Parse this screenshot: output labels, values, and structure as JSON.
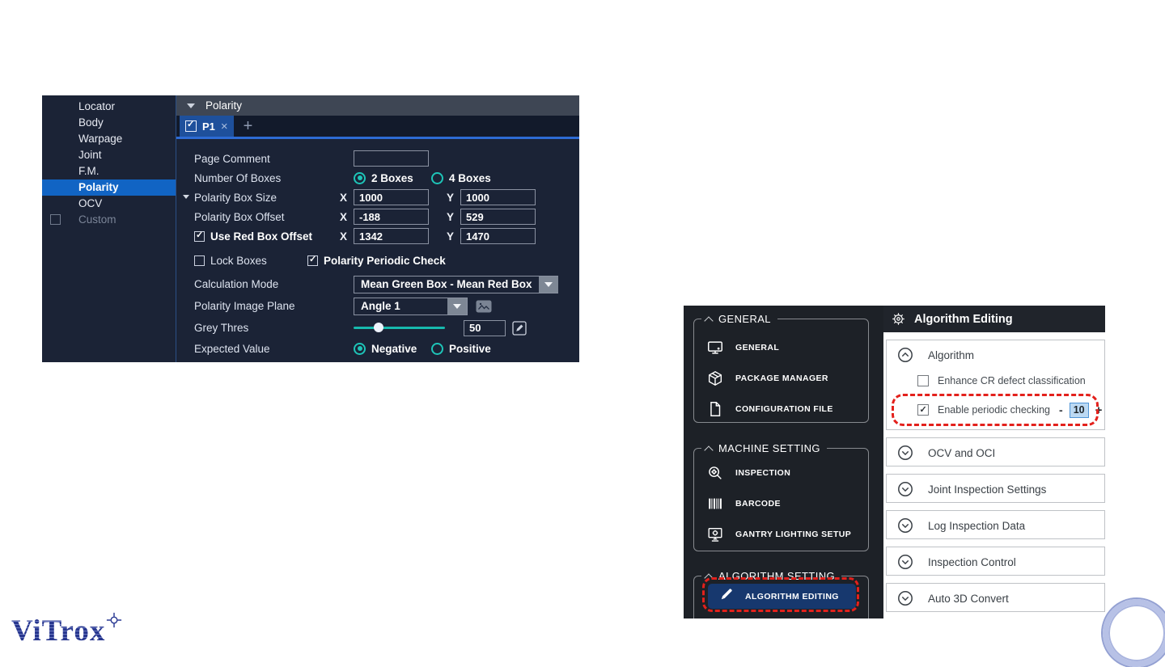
{
  "colors": {
    "left_panel_bg": "#1b2336",
    "left_header_bg": "#3e4654",
    "left_selected_blue": "#1164c4",
    "tab_blue": "#1e509c",
    "tab_underline_blue": "#2d6bd4",
    "teal_accent": "#1ec4b8",
    "input_border": "#8b92a2",
    "right_sidebar_bg": "#1d2127",
    "right_header_bg": "#20242b",
    "algorithm_editing_highlight": "#17386e",
    "annotation_red": "#e3211c",
    "stepper_value_bg": "#bcd9f3",
    "stepper_value_border": "#4f94d6",
    "logo_navy": "#2b3a94",
    "ring_color": "#b7c1e6"
  },
  "logo": {
    "text": "ViTrox",
    "crosshair_icon": "crosshair-icon"
  },
  "left_panel": {
    "sidebar": {
      "items": [
        {
          "label": "Locator"
        },
        {
          "label": "Body"
        },
        {
          "label": "Warpage"
        },
        {
          "label": "Joint"
        },
        {
          "label": "F.M."
        },
        {
          "label": "Polarity",
          "selected": true
        },
        {
          "label": "OCV"
        },
        {
          "label": "Custom",
          "disabled": true,
          "has_checkbox": true,
          "checked": false
        }
      ]
    },
    "header": {
      "title": "Polarity",
      "collapse_icon": "triangle-down-icon"
    },
    "tabs": {
      "p1": {
        "checked": true,
        "label": "P1",
        "close_label": "×"
      },
      "add_label": "+"
    },
    "rows": {
      "page_comment": {
        "label": "Page Comment",
        "value": ""
      },
      "number_of_boxes": {
        "label": "Number Of Boxes",
        "options": [
          {
            "label": "2 Boxes",
            "selected": true
          },
          {
            "label": "4 Boxes",
            "selected": false
          }
        ]
      },
      "box_size": {
        "label": "Polarity Box Size",
        "x_label": "X",
        "x": "1000",
        "y_label": "Y",
        "y": "1000"
      },
      "box_offset": {
        "label": "Polarity Box Offset",
        "x_label": "X",
        "x": "-188",
        "y_label": "Y",
        "y": "529"
      },
      "red_box_offset": {
        "label": "Use Red Box Offset",
        "checked": true,
        "x_label": "X",
        "x": "1342",
        "y_label": "Y",
        "y": "1470"
      },
      "lock_boxes": {
        "label": "Lock Boxes",
        "checked": false
      },
      "periodic_check": {
        "label": "Polarity Periodic Check",
        "checked": true
      },
      "calculation_mode": {
        "label": "Calculation Mode",
        "value": "Mean Green Box - Mean Red Box"
      },
      "image_plane": {
        "label": "Polarity Image Plane",
        "value": "Angle 1",
        "preview_icon": "image-icon"
      },
      "grey_thres": {
        "label": "Grey Thres",
        "value": "50",
        "slider_pos_pct": 22,
        "edit_icon": "edit-icon"
      },
      "expected_value": {
        "label": "Expected Value",
        "options": [
          {
            "label": "Negative",
            "selected": true
          },
          {
            "label": "Positive",
            "selected": false
          }
        ]
      }
    }
  },
  "right_panel": {
    "sidebar": {
      "groups": [
        {
          "label": "GENERAL",
          "items": [
            {
              "icon": "monitor-icon",
              "label": "GENERAL"
            },
            {
              "icon": "package-icon",
              "label": "PACKAGE MANAGER"
            },
            {
              "icon": "document-icon",
              "label": "CONFIGURATION FILE"
            }
          ]
        },
        {
          "label": "MACHINE SETTING",
          "items": [
            {
              "icon": "inspection-magnifier-icon",
              "label": "INSPECTION"
            },
            {
              "icon": "barcode-icon",
              "label": "BARCODE"
            },
            {
              "icon": "gantry-monitor-icon",
              "label": "GANTRY LIGHTING SETUP"
            }
          ]
        },
        {
          "label": "ALGORITHM SETTING",
          "items": [
            {
              "icon": "pencil-icon",
              "label": "ALGORITHM EDITING",
              "selected": true,
              "annotated_red_dashed": true
            }
          ]
        }
      ]
    },
    "content": {
      "header": {
        "icon": "gear-icon",
        "title": "Algorithm Editing"
      },
      "sections": [
        {
          "label": "Algorithm",
          "expanded": true,
          "items": [
            {
              "label": "Enhance CR defect classification",
              "checked": false
            },
            {
              "label": "Enable periodic checking",
              "checked": true,
              "annotated_red_dashed": true,
              "stepper": {
                "minus_label": "-",
                "value": "10",
                "plus_label": "+"
              }
            }
          ]
        },
        {
          "label": "OCV and OCI",
          "expanded": false
        },
        {
          "label": "Joint Inspection Settings",
          "expanded": false
        },
        {
          "label": "Log Inspection Data",
          "expanded": false
        },
        {
          "label": "Inspection Control",
          "expanded": false
        },
        {
          "label": "Auto 3D Convert",
          "expanded": false
        }
      ]
    }
  }
}
